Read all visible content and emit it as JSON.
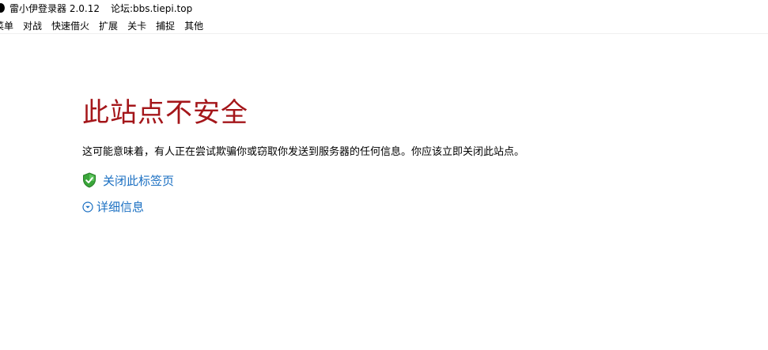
{
  "window": {
    "title_app": "雷小伊登录器 2.0.12",
    "title_forum": "论坛:bbs.tiepi.top"
  },
  "menu": {
    "items": [
      "菜单",
      "对战",
      "快速借火",
      "扩展",
      "关卡",
      "捕捉",
      "其他"
    ]
  },
  "page": {
    "heading": "此站点不安全",
    "description": "这可能意味着，有人正在尝试欺骗你或窃取你发送到服务器的任何信息。你应该立即关闭此站点。",
    "close_tab_label": "关闭此标签页",
    "details_label": "详细信息"
  },
  "colors": {
    "heading": "#a4161a",
    "link": "#1a6fc2",
    "shield_green": "#3aa63a"
  },
  "icons": {
    "app": "app-icon",
    "shield": "shield-check-icon",
    "details": "chevron-down-circle-icon"
  }
}
